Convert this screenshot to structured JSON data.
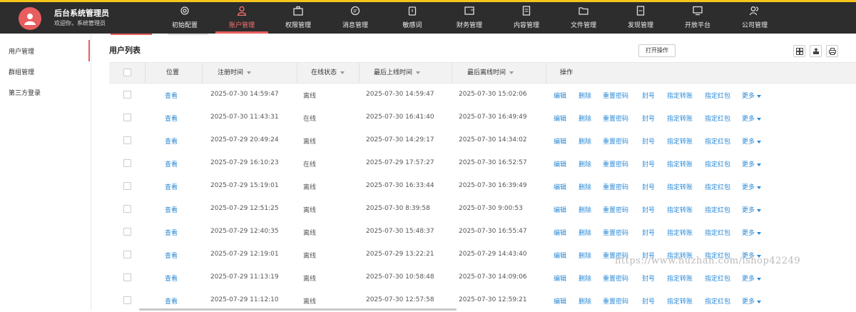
{
  "brand": {
    "title": "后台系统管理员",
    "welcome": "欢迎你，系统管理员"
  },
  "nav": [
    {
      "label": "初始配置",
      "icon": "gear-icon"
    },
    {
      "label": "账户管理",
      "icon": "user-icon",
      "active": true
    },
    {
      "label": "权限管理",
      "icon": "briefcase-icon"
    },
    {
      "label": "消息管理",
      "icon": "message-icon"
    },
    {
      "label": "敏感词",
      "icon": "clipboard-icon"
    },
    {
      "label": "财务管理",
      "icon": "wallet-icon"
    },
    {
      "label": "内容管理",
      "icon": "document-icon"
    },
    {
      "label": "文件管理",
      "icon": "folder-icon"
    },
    {
      "label": "发现管理",
      "icon": "file-icon"
    },
    {
      "label": "开放平台",
      "icon": "monitor-icon"
    },
    {
      "label": "公司管理",
      "icon": "users-icon"
    }
  ],
  "sidebar": {
    "items": [
      {
        "label": "用户管理",
        "active": true
      },
      {
        "label": "群组管理"
      },
      {
        "label": "第三方登录"
      }
    ]
  },
  "main": {
    "title": "用户列表",
    "open_action": "打开操作",
    "toolbar_icons": [
      "columns-icon",
      "export-icon",
      "print-icon"
    ]
  },
  "table": {
    "headers": {
      "position": "位置",
      "register": "注册时间",
      "online": "在线状态",
      "last_online": "最后上线时间",
      "last_offline": "最后离线时间",
      "actions": "操作"
    },
    "view_label": "查看",
    "action_labels": [
      "编辑",
      "删除",
      "重置密码",
      "封号",
      "指定转账",
      "指定红包",
      "更多"
    ],
    "rows": [
      {
        "register": "2025-07-30 14:59:47",
        "status": "离线",
        "last_online": "2025-07-30 14:59:47",
        "last_offline": "2025-07-30 15:02:06"
      },
      {
        "register": "2025-07-30 11:43:31",
        "status": "在线",
        "last_online": "2025-07-30 16:41:40",
        "last_offline": "2025-07-30 16:49:49"
      },
      {
        "register": "2025-07-29 20:49:24",
        "status": "离线",
        "last_online": "2025-07-30 14:29:17",
        "last_offline": "2025-07-30 14:34:02"
      },
      {
        "register": "2025-07-29 16:10:23",
        "status": "在线",
        "last_online": "2025-07-29 17:57:27",
        "last_offline": "2025-07-30 16:52:57"
      },
      {
        "register": "2025-07-29 15:19:01",
        "status": "离线",
        "last_online": "2025-07-30 16:33:44",
        "last_offline": "2025-07-30 16:39:49"
      },
      {
        "register": "2025-07-29 12:51:25",
        "status": "离线",
        "last_online": "2025-07-30 8:39:58",
        "last_offline": "2025-07-30 9:00:53"
      },
      {
        "register": "2025-07-29 12:40:35",
        "status": "离线",
        "last_online": "2025-07-30 15:48:37",
        "last_offline": "2025-07-30 16:55:47"
      },
      {
        "register": "2025-07-29 12:19:01",
        "status": "离线",
        "last_online": "2025-07-29 13:22:21",
        "last_offline": "2025-07-29 14:43:40"
      },
      {
        "register": "2025-07-29 11:13:19",
        "status": "离线",
        "last_online": "2025-07-30 10:58:48",
        "last_offline": "2025-07-30 14:09:06"
      },
      {
        "register": "2025-07-29 11:12:10",
        "status": "离线",
        "last_online": "2025-07-30 12:57:58",
        "last_offline": "2025-07-30 12:59:21"
      }
    ]
  },
  "watermark": "https://www.huzhan.com/ishop42249",
  "colors": {
    "accent": "#e85d5d",
    "link": "#2b8ad6",
    "topbar": "#2d2d2d"
  }
}
